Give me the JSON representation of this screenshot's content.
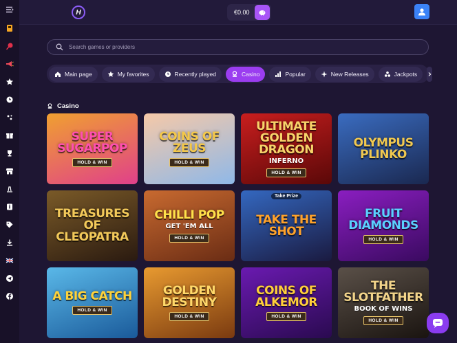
{
  "header": {
    "logo_letter": "H",
    "balance": "€0.00",
    "wallet_icon": "wallet-icon",
    "user_icon": "user-icon"
  },
  "sidebar": {
    "items": [
      {
        "name": "menu-toggle",
        "icon": "menu-icon"
      },
      {
        "name": "promo",
        "icon": "ticket-icon"
      },
      {
        "name": "sports",
        "icon": "pin-icon"
      },
      {
        "name": "promotions",
        "icon": "megaphone-icon"
      },
      {
        "name": "favorites",
        "icon": "star-icon"
      },
      {
        "name": "recent",
        "icon": "recent-icon"
      },
      {
        "name": "slots",
        "icon": "dice-icon"
      },
      {
        "name": "gifts",
        "icon": "gift-icon"
      },
      {
        "name": "tournaments",
        "icon": "trophy-icon"
      },
      {
        "name": "shop",
        "icon": "store-icon"
      },
      {
        "name": "vip",
        "icon": "crown-icon"
      },
      {
        "name": "info",
        "icon": "info-icon"
      },
      {
        "name": "tags",
        "icon": "tag-icon"
      },
      {
        "name": "download",
        "icon": "download-icon"
      },
      {
        "name": "language",
        "icon": "uk-flag-icon"
      },
      {
        "name": "telegram",
        "icon": "telegram-icon"
      },
      {
        "name": "facebook",
        "icon": "facebook-icon"
      }
    ]
  },
  "search": {
    "placeholder": "Search games or providers"
  },
  "tabs": [
    {
      "label": "Main page",
      "icon": "home-icon",
      "active": false
    },
    {
      "label": "My favorites",
      "icon": "star-icon",
      "active": false
    },
    {
      "label": "Recently played",
      "icon": "recent-icon",
      "active": false
    },
    {
      "label": "Casino",
      "icon": "casino-icon",
      "active": true
    },
    {
      "label": "Popular",
      "icon": "popular-icon",
      "active": false
    },
    {
      "label": "New Releases",
      "icon": "new-icon",
      "active": false
    },
    {
      "label": "Jackpots",
      "icon": "jackpot-icon",
      "active": false
    }
  ],
  "tabs_next_icon": "chevron-right-icon",
  "section": {
    "title": "Casino",
    "icon": "casino-icon"
  },
  "games": [
    {
      "title": "SUPER SUGARPOP",
      "sub": "",
      "badge": "HOLD & WIN",
      "top": "",
      "bg1": "#f0a030",
      "bg2": "#e0408a",
      "color": "#ff4fb0"
    },
    {
      "title": "COINS OF ZEUS",
      "sub": "",
      "badge": "HOLD & WIN",
      "top": "",
      "bg1": "#f6c9a8",
      "bg2": "#8fb8e8",
      "color": "#f4c84a"
    },
    {
      "title": "ULTIMATE GOLDEN DRAGON",
      "sub": "INFERNO",
      "badge": "HOLD & WIN",
      "top": "",
      "bg1": "#c81e1e",
      "bg2": "#5a0808",
      "color": "#f7d36a"
    },
    {
      "title": "OLYMPUS PLINKO",
      "sub": "",
      "badge": "",
      "top": "",
      "bg1": "#3a6cc0",
      "bg2": "#1a2850",
      "color": "#f0c850"
    },
    {
      "title": "TREASURES OF CLEOPATRA",
      "sub": "",
      "badge": "",
      "top": "",
      "bg1": "#7a5a28",
      "bg2": "#2a1a10",
      "color": "#f2c95a"
    },
    {
      "title": "CHILLI POP",
      "sub": "GET 'EM ALL",
      "badge": "HOLD & WIN",
      "top": "",
      "bg1": "#c86a30",
      "bg2": "#6a2c14",
      "color": "#ffe14a"
    },
    {
      "title": "TAKE THE SHOT",
      "sub": "",
      "badge": "",
      "top": "Take Prize",
      "bg1": "#3468c0",
      "bg2": "#1a1a40",
      "color": "#ffa22a"
    },
    {
      "title": "FRUIT DIAMONDS",
      "sub": "",
      "badge": "HOLD & WIN",
      "top": "",
      "bg1": "#8a1ec0",
      "bg2": "#3a0a60",
      "color": "#5ad0ff"
    },
    {
      "title": "A BIG CATCH",
      "sub": "",
      "badge": "HOLD & WIN",
      "top": "",
      "bg1": "#5ab8e8",
      "bg2": "#1a5a9a",
      "color": "#ffd23a"
    },
    {
      "title": "GOLDEN DESTINY",
      "sub": "",
      "badge": "HOLD & WIN",
      "top": "",
      "bg1": "#e89a30",
      "bg2": "#7a3a10",
      "color": "#ffd86a"
    },
    {
      "title": "COINS OF ALKEMOR",
      "sub": "",
      "badge": "HOLD & WIN",
      "top": "",
      "bg1": "#6a1ab0",
      "bg2": "#2a0a50",
      "color": "#ffcf3a"
    },
    {
      "title": "THE SLOTFATHER",
      "sub": "BOOK OF WINS",
      "badge": "HOLD & WIN",
      "top": "",
      "bg1": "#5a5048",
      "bg2": "#1a1410",
      "color": "#f2d48a"
    }
  ],
  "chat_icon": "chat-icon"
}
